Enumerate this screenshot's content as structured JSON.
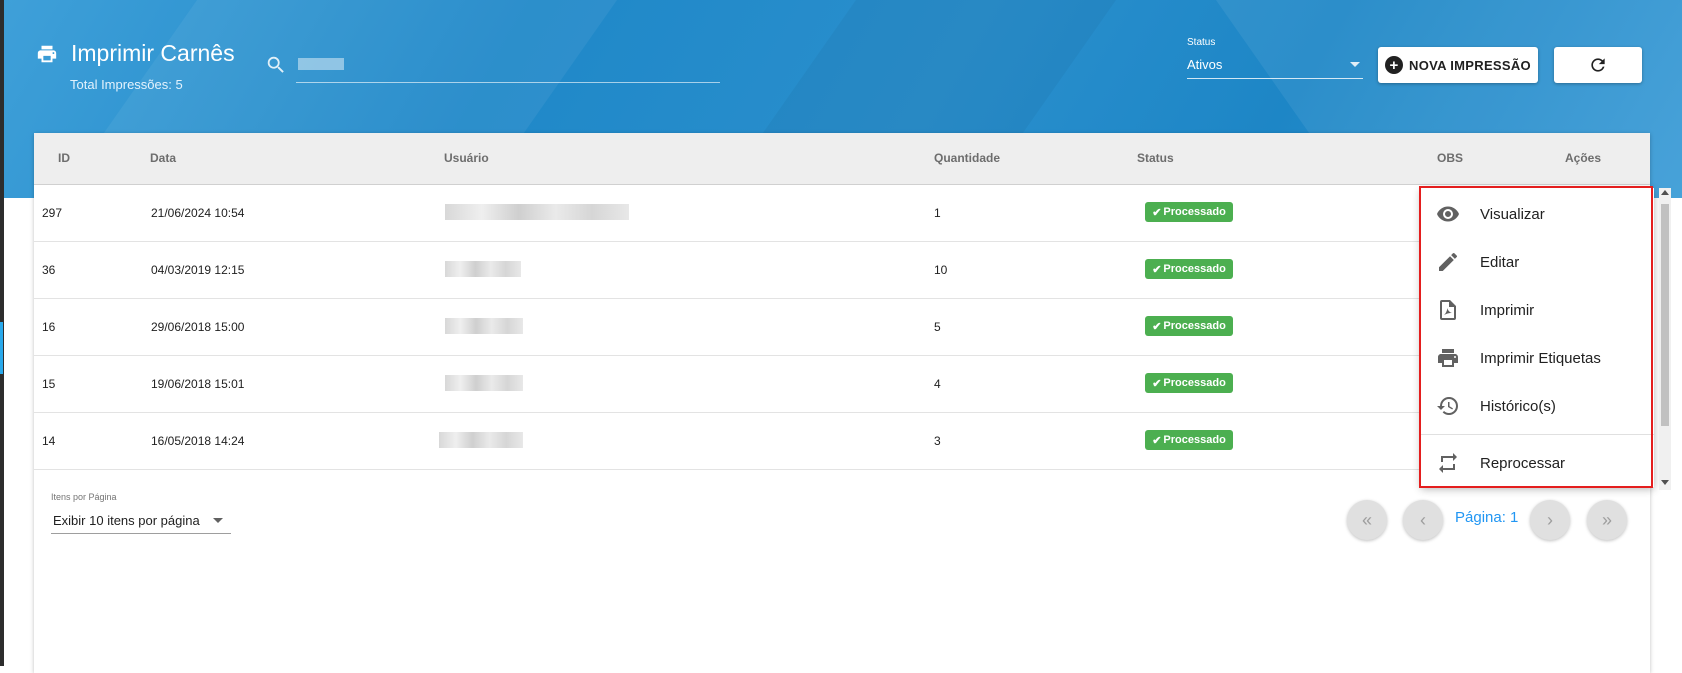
{
  "header": {
    "title": "Imprimir Carnês",
    "subtitle": "Total Impressões: 5",
    "search": {
      "value": "",
      "placeholder": ""
    },
    "status_filter": {
      "label": "Status",
      "value": "Ativos"
    },
    "new_button_label": "NOVA IMPRESSÃO"
  },
  "table": {
    "columns": [
      "ID",
      "Data",
      "Usuário",
      "Quantidade",
      "Status",
      "OBS",
      "Ações"
    ],
    "rows": [
      {
        "id": "297",
        "data": "21/06/2024 10:54",
        "quantidade": "1",
        "status": "Processado"
      },
      {
        "id": "36",
        "data": "04/03/2019 12:15",
        "quantidade": "10",
        "status": "Processado"
      },
      {
        "id": "16",
        "data": "29/06/2018 15:00",
        "quantidade": "5",
        "status": "Processado"
      },
      {
        "id": "15",
        "data": "19/06/2018 15:01",
        "quantidade": "4",
        "status": "Processado"
      },
      {
        "id": "14",
        "data": "16/05/2018 14:24",
        "quantidade": "3",
        "status": "Processado"
      }
    ]
  },
  "pagination": {
    "items_per_page_label": "Itens por Página",
    "items_per_page_value": "Exibir 10 itens por página",
    "page_label": "Página: 1"
  },
  "actions_menu": {
    "items": [
      {
        "label": "Visualizar",
        "icon": "eye-icon"
      },
      {
        "label": "Editar",
        "icon": "pencil-icon"
      },
      {
        "label": "Imprimir",
        "icon": "pdf-icon"
      },
      {
        "label": "Imprimir Etiquetas",
        "icon": "printer-icon"
      },
      {
        "label": "Histórico(s)",
        "icon": "history-icon"
      },
      {
        "label": "Reprocessar",
        "icon": "repeat-icon"
      }
    ]
  },
  "colors": {
    "header_blue": "#1f88c8",
    "badge_green": "#4caf50",
    "page_link_blue": "#2196f3",
    "highlight_red": "#e41e1e"
  }
}
